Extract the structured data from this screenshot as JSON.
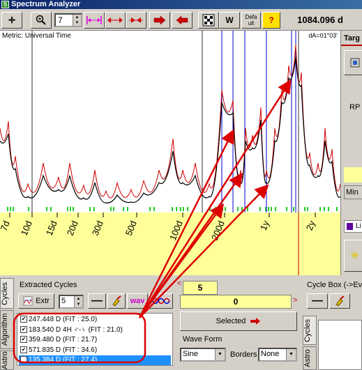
{
  "window": {
    "title": "Spectrum Analyzer"
  },
  "toolbar": {
    "zoom_value": "7",
    "defa_label": "Defa ult",
    "w_label": "W",
    "help_label": "?",
    "readout": "1084.096 d"
  },
  "chart": {
    "metric_label": "Metric: Universal Time",
    "da_label": "dA=01°03'",
    "x_tick_labels": [
      "7d",
      "10d",
      "15d",
      "20d",
      "30d",
      "50d",
      "100d",
      "200d",
      "1y",
      "2y"
    ]
  },
  "right_panel": {
    "tab_label": "Targ",
    "rp_label": "RP",
    "min_label": "Min",
    "color_label": "Li"
  },
  "bottom_tabs": {
    "cycles": "Cycles",
    "algorithm": "Algorithm",
    "astro": "Astro"
  },
  "extracted_cycles": {
    "group_label": "Extracted Cycles",
    "extr_label": "Extr",
    "count_value": "5",
    "wave_label": "wav",
    "items": [
      {
        "text": "247.448 D  (FIT : 25.0)",
        "checked": true,
        "selected": false
      },
      {
        "text": "183.540 D 4H ♂-♄  (FIT : 21.0)",
        "checked": true,
        "selected": false
      },
      {
        "text": "359.480 D  (FIT : 21.7)",
        "checked": true,
        "selected": false
      },
      {
        "text": "571.835 D  (FIT : 34.6)",
        "checked": true,
        "selected": false
      },
      {
        "text": "135.384 D  (FIT : 27.4)",
        "checked": true,
        "selected": true
      }
    ]
  },
  "selection": {
    "count_value": "5",
    "offset_value": "0",
    "selected_label": "Selected"
  },
  "wave_form": {
    "group_label": "Wave Form",
    "type_value": "Sine",
    "borders_label": "Borders",
    "borders_value": "None"
  },
  "cycle_box": {
    "group_label": "Cycle Box (->Eve",
    "tab_cycles": "Cycles",
    "tab_astro": "Astro"
  },
  "colors": {
    "accent_red": "#cc0000",
    "cycle_blue": "#0000cc",
    "highlight_yellow": "#ffff99",
    "selection_blue": "#1e90ff"
  }
}
